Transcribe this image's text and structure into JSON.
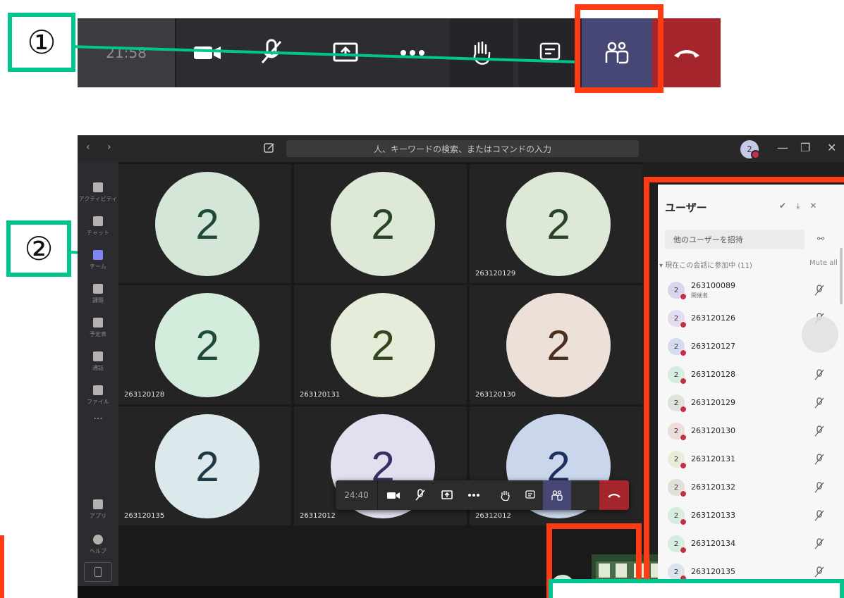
{
  "callouts": {
    "one": "①",
    "two": "②"
  },
  "toolbar_strip": {
    "time": "21:58"
  },
  "window": {
    "search_placeholder": "人、キーワードの検索、またはコマンドの入力",
    "avatar_initial": "2"
  },
  "rail": [
    {
      "label": "アクティビティ",
      "icon": "bell-icon"
    },
    {
      "label": "チャット",
      "icon": "chat-icon"
    },
    {
      "label": "チーム",
      "icon": "teams-icon"
    },
    {
      "label": "課題",
      "icon": "assignments-icon"
    },
    {
      "label": "予定表",
      "icon": "calendar-icon"
    },
    {
      "label": "通話",
      "icon": "phone-icon"
    },
    {
      "label": "ファイル",
      "icon": "files-icon"
    },
    {
      "label": "アプリ",
      "icon": "apps-icon"
    },
    {
      "label": "ヘルプ",
      "icon": "help-icon"
    }
  ],
  "tiles": [
    {
      "initial": "2",
      "name": "",
      "bg": "#d3e6d8",
      "fg": "#1e4a3a"
    },
    {
      "initial": "2",
      "name": "",
      "bg": "#dde8d7",
      "fg": "#2a4426"
    },
    {
      "initial": "2",
      "name": "263120129",
      "bg": "#dde8d7",
      "fg": "#2a4426"
    },
    {
      "initial": "2",
      "name": "263120128",
      "bg": "#d4ecdb",
      "fg": "#1e4a3a"
    },
    {
      "initial": "2",
      "name": "263120131",
      "bg": "#e5ecd9",
      "fg": "#34461e"
    },
    {
      "initial": "2",
      "name": "263120130",
      "bg": "#ede0d8",
      "fg": "#4a2e1e"
    },
    {
      "initial": "2",
      "name": "263120135",
      "bg": "#dbe9ec",
      "fg": "#1f3a44"
    },
    {
      "initial": "2",
      "name": "26312012",
      "bg": "#e3dff0",
      "fg": "#3a3060"
    },
    {
      "initial": "2",
      "name": "26312012",
      "bg": "#c9d6ec",
      "fg": "#1e3060"
    }
  ],
  "ctrlbar": {
    "time": "24:40"
  },
  "self_avatar": "2",
  "panel": {
    "title": "ユーザー",
    "invite_placeholder": "他のユーザーを招待",
    "section": "現在この会話に参加中 (11)",
    "mute_all": "Mute all",
    "users": [
      {
        "initial": "2",
        "id": "263100089",
        "role": "開催者",
        "color": "#d8d5ec"
      },
      {
        "initial": "2",
        "id": "263120126",
        "role": "",
        "color": "#e3dbef"
      },
      {
        "initial": "2",
        "id": "263120127",
        "role": "",
        "color": "#d5dbef"
      },
      {
        "initial": "2",
        "id": "263120128",
        "role": "",
        "color": "#d6ecdc"
      },
      {
        "initial": "2",
        "id": "263120129",
        "role": "",
        "color": "#dde3d8"
      },
      {
        "initial": "2",
        "id": "263120130",
        "role": "",
        "color": "#eedcd8"
      },
      {
        "initial": "2",
        "id": "263120131",
        "role": "",
        "color": "#e8edd8"
      },
      {
        "initial": "2",
        "id": "263120132",
        "role": "",
        "color": "#e0e0d6"
      },
      {
        "initial": "2",
        "id": "263120133",
        "role": "",
        "color": "#d6ecdc"
      },
      {
        "initial": "2",
        "id": "263120134",
        "role": "",
        "color": "#d6ecdc"
      },
      {
        "initial": "2",
        "id": "263120135",
        "role": "",
        "color": "#dbe3ec"
      }
    ]
  },
  "colors": {
    "accent_red": "#ff3b14",
    "callout_green": "#00c58e",
    "people_button": "#464775",
    "hangup": "#a4262c"
  }
}
